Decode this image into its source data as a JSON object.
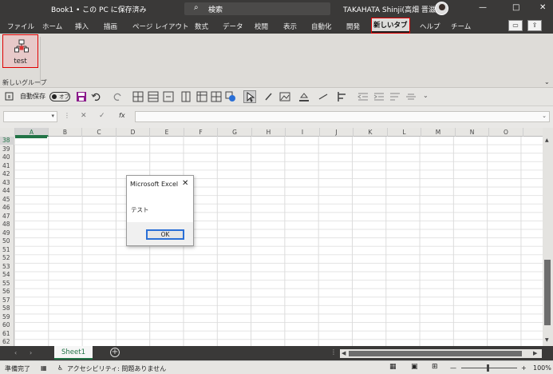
{
  "titlebar": {
    "doc_title": "Book1 • この PC に保存済み",
    "search_placeholder": "検索",
    "user_name": "TAKAHATA Shinji(高畑 晋滋)",
    "minimize": "—",
    "restore": "□",
    "close": "✕"
  },
  "ribbon_tabs": [
    "ファイル",
    "ホーム",
    "挿入",
    "描画",
    "ページ レイアウト",
    "数式",
    "データ",
    "校閲",
    "表示",
    "自動化",
    "開発",
    "新しいタブ",
    "ヘルプ",
    "チーム"
  ],
  "ribbon": {
    "test_button_label": "test",
    "group_label": "新しいグループ"
  },
  "qat": {
    "autosave_label": "自動保存",
    "autosave_state": "オフ"
  },
  "formula_bar": {
    "fx": "fx",
    "cancel": "✕",
    "enter": "✓",
    "name_box": "",
    "formula": ""
  },
  "columns": [
    "A",
    "B",
    "C",
    "D",
    "E",
    "F",
    "G",
    "H",
    "I",
    "J",
    "K",
    "L",
    "M",
    "N",
    "O"
  ],
  "rows": [
    "38",
    "39",
    "40",
    "41",
    "42",
    "43",
    "44",
    "45",
    "46",
    "47",
    "48",
    "49",
    "50",
    "51",
    "52",
    "53",
    "54",
    "55",
    "56",
    "57",
    "58",
    "59",
    "60",
    "61",
    "62"
  ],
  "dialog": {
    "title": "Microsoft Excel",
    "message": "テスト",
    "ok_label": "OK"
  },
  "sheets": {
    "active": "Sheet1",
    "add": "+"
  },
  "status": {
    "ready": "準備完了",
    "accessibility": "アクセシビリティ: 問題ありません",
    "zoom": "100%"
  },
  "colors": {
    "accent_green": "#217346",
    "highlight_red": "#e00000",
    "titlebar_bg": "#3a3938"
  }
}
